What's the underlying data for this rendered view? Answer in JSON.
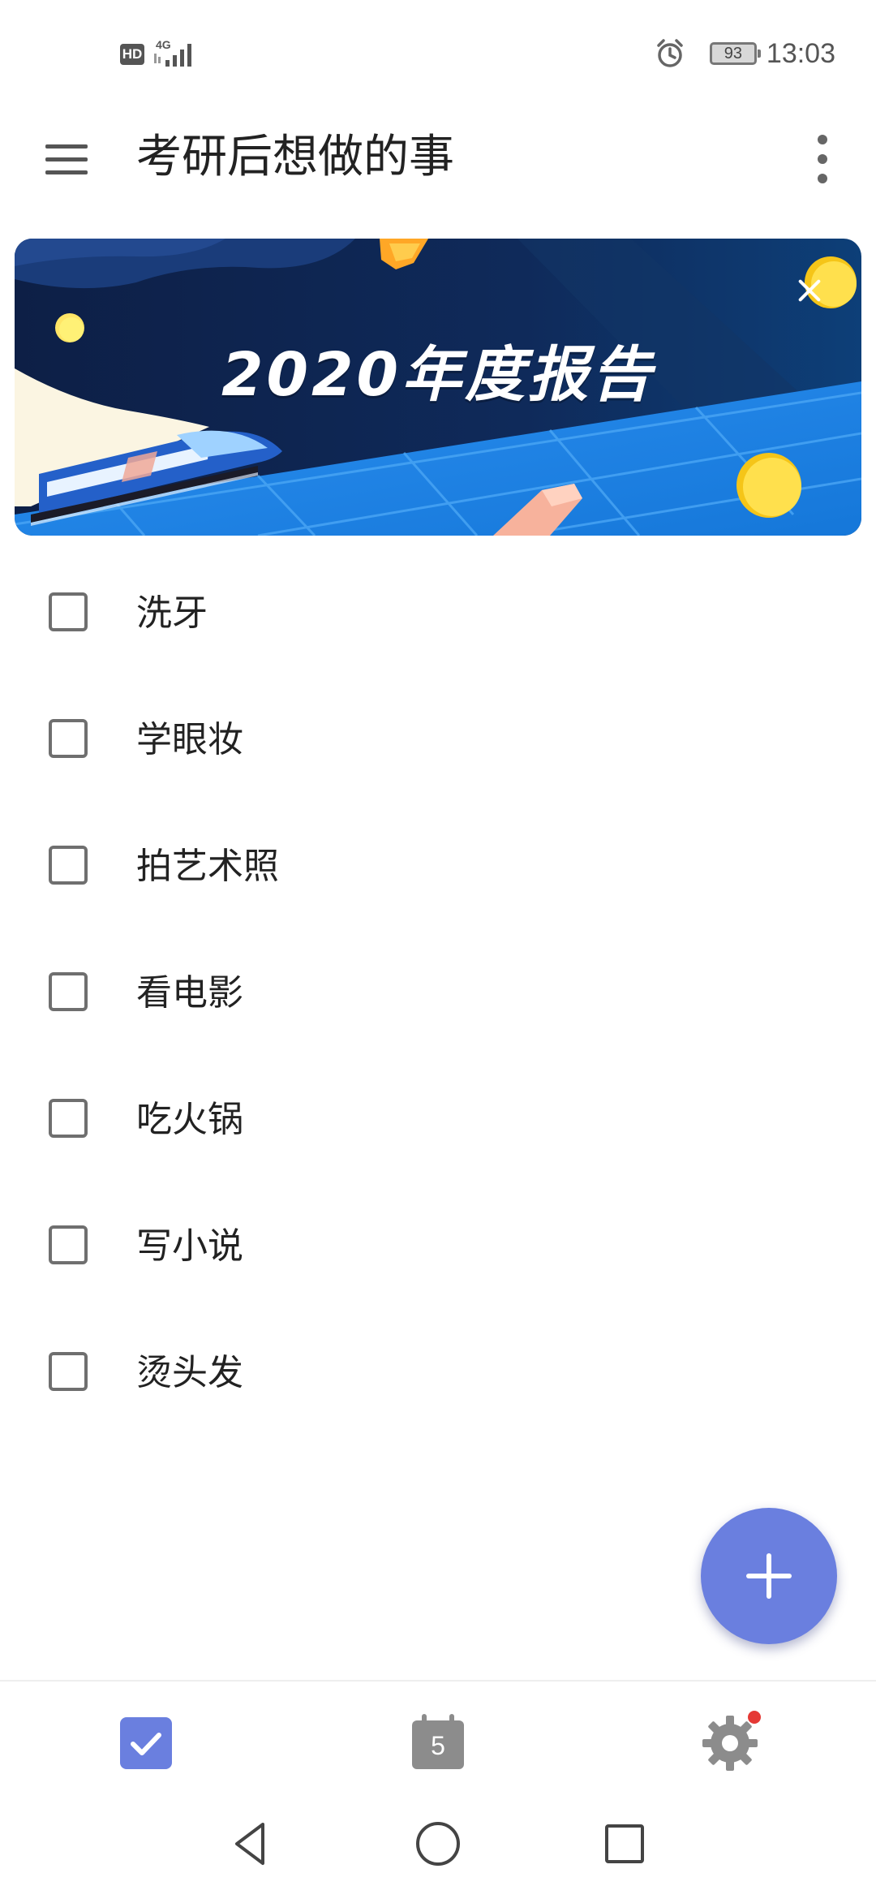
{
  "status_bar": {
    "hd_label": "HD",
    "network_label": "4G",
    "battery_level": "93",
    "time": "13:03",
    "icons": [
      "signal-icon",
      "alarm-icon",
      "battery-icon"
    ]
  },
  "app_bar": {
    "title": "考研后想做的事",
    "menu_icon": "hamburger-menu-icon",
    "overflow_icon": "more-vert-icon"
  },
  "banner": {
    "title": "2020年度报告",
    "close_icon": "close-icon"
  },
  "tasks": [
    {
      "label": "洗牙",
      "checked": false
    },
    {
      "label": "学眼妆",
      "checked": false
    },
    {
      "label": "拍艺术照",
      "checked": false
    },
    {
      "label": "看电影",
      "checked": false
    },
    {
      "label": "吃火锅",
      "checked": false
    },
    {
      "label": "写小说",
      "checked": false
    },
    {
      "label": "烫头发",
      "checked": false
    }
  ],
  "fab": {
    "icon": "plus-icon"
  },
  "bottom_nav": {
    "calendar_day": "5",
    "items": [
      "todo-checkbox-icon",
      "calendar-icon",
      "settings-icon"
    ]
  },
  "colors": {
    "accent": "#6a7fdf",
    "banner_navy": "#0f2147",
    "banner_blue": "#1a8ae5",
    "badge_red": "#e53935"
  }
}
